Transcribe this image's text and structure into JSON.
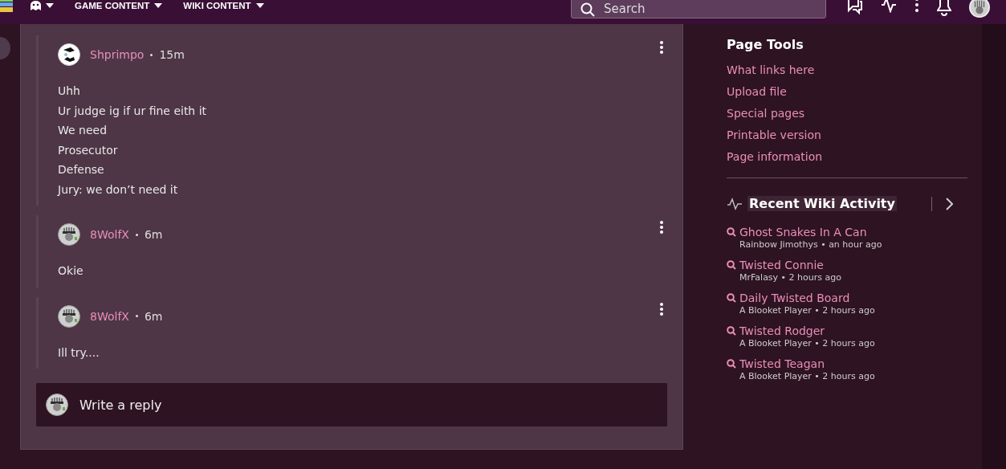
{
  "header": {
    "nav": [
      {
        "kind": "icon"
      },
      {
        "kind": "text",
        "label": "GAME CONTENT"
      },
      {
        "kind": "text",
        "label": "WIKI CONTENT"
      }
    ],
    "search": {
      "placeholder": "Search"
    }
  },
  "thread": {
    "replies": [
      {
        "author": "Shprimpo",
        "time": "15m",
        "lines": [
          "Uhh",
          "Ur judge ig if ur fine eith it",
          "We need",
          "Prosecutor",
          "Defense",
          "Jury: we don’t need it"
        ]
      },
      {
        "author": "8WolfX",
        "time": "6m",
        "lines": [
          "Okie"
        ]
      },
      {
        "author": "8WolfX",
        "time": "6m",
        "lines": [
          "Ill try...."
        ]
      }
    ],
    "reply_box": {
      "placeholder": "Write a reply"
    }
  },
  "page_tools": {
    "title": "Page Tools",
    "links": [
      "What links here",
      "Upload file",
      "Special pages",
      "Printable version",
      "Page information"
    ]
  },
  "recent_activity": {
    "title": "Recent Wiki Activity",
    "items": [
      {
        "page": "Ghost Snakes In A Can",
        "meta": "Rainbow Jimothys • an hour ago"
      },
      {
        "page": "Twisted Connie",
        "meta": "MrFalasy • 2 hours ago"
      },
      {
        "page": "Daily Twisted Board",
        "meta": "A Blooket Player • 2 hours ago"
      },
      {
        "page": "Twisted Rodger",
        "meta": "A Blooket Player • 2 hours ago"
      },
      {
        "page": "Twisted Teagan",
        "meta": "A Blooket Player • 2 hours ago"
      }
    ]
  }
}
